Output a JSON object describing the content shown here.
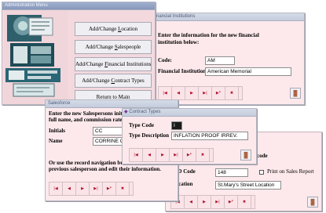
{
  "admin_menu": {
    "title": "Administration Menu",
    "buttons": [
      {
        "pre": "Add/Change ",
        "key": "L",
        "post": "ocation"
      },
      {
        "pre": "Add/Change ",
        "key": "S",
        "post": "alespeople"
      },
      {
        "pre": "Add/Change ",
        "key": "F",
        "post": "inancial Institutions"
      },
      {
        "pre": "Add/Change ",
        "key": "C",
        "post": "ontract Types"
      },
      {
        "pre": "",
        "key": "R",
        "post": "eturn to Main"
      }
    ]
  },
  "financial": {
    "title": "Financial Institutions",
    "instructions": "Enter the information for the new financial institution below:",
    "code_label": "Code:",
    "code_value": "AM",
    "name_label": "Financial Institution:",
    "name_value": "American Memorial"
  },
  "sales": {
    "title": "Salesforce",
    "instructions": "Enter the new Salespersons initials and full name, and commission rate below:",
    "initials_label": "Initials",
    "initials_value": "CC",
    "name_label": "Name",
    "name_value": "CORRINE C",
    "nav_text": "Or use the record navigation buttons to locate a previous salesperson and edit their information."
  },
  "contract": {
    "title": "Contract Types",
    "code_label": "Type Code",
    "code_value": "I",
    "desc_label": "Type Description",
    "desc_value": "INFLATION PROOF IRREV."
  },
  "location": {
    "header_tail": "code",
    "lid_label": "LID Code",
    "lid_value": "148",
    "print_label": "Print on Sales Report",
    "loc_label": "Location",
    "loc_value": "St.Mary's Street Location"
  },
  "nav_glyphs": [
    "|◀",
    "◀",
    "▶",
    "▶|",
    "▶*",
    "✖"
  ],
  "icons": {
    "exit": "exit-door-icon",
    "nav": [
      "first-record-icon",
      "prev-record-icon",
      "next-record-icon",
      "last-record-icon",
      "new-record-icon",
      "delete-record-icon"
    ]
  }
}
